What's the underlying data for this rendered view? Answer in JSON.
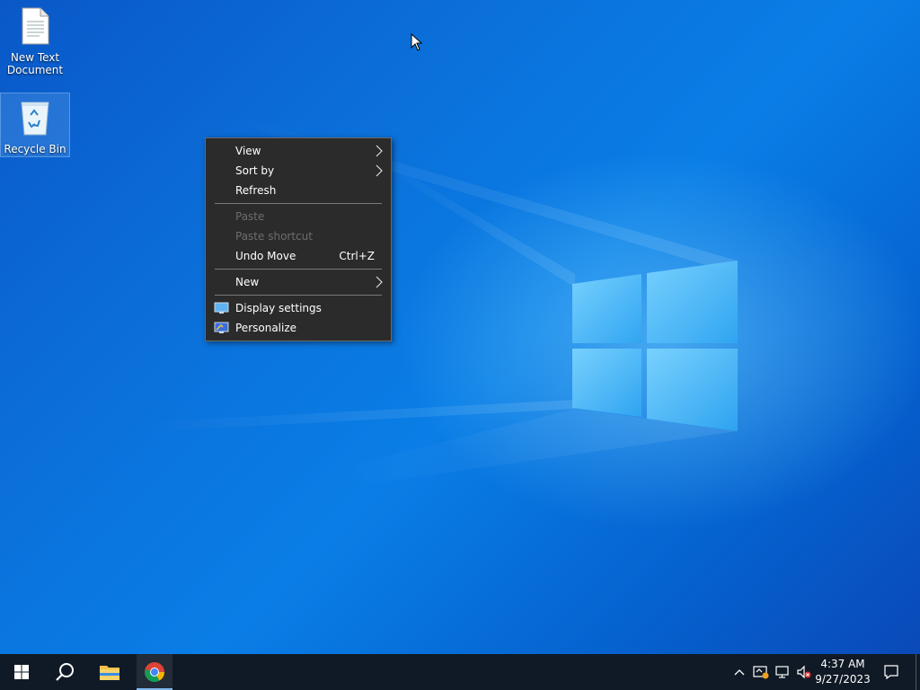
{
  "desktop": {
    "icons": [
      {
        "label": "New Text Document",
        "icon": "text-document-icon"
      },
      {
        "label": "Recycle Bin",
        "icon": "recycle-bin-icon"
      }
    ]
  },
  "context_menu": {
    "items": {
      "view": {
        "label": "View",
        "submenu": true
      },
      "sort_by": {
        "label": "Sort by",
        "submenu": true
      },
      "refresh": {
        "label": "Refresh"
      },
      "paste": {
        "label": "Paste",
        "disabled": true
      },
      "paste_shortcut": {
        "label": "Paste shortcut",
        "disabled": true
      },
      "undo_move": {
        "label": "Undo Move",
        "shortcut": "Ctrl+Z"
      },
      "new": {
        "label": "New",
        "submenu": true
      },
      "display_settings": {
        "label": "Display settings",
        "icon": "display-settings-icon"
      },
      "personalize": {
        "label": "Personalize",
        "icon": "personalize-icon"
      }
    }
  },
  "taskbar": {
    "buttons": [
      {
        "name": "start",
        "icon": "windows-start-icon"
      },
      {
        "name": "search",
        "icon": "search-icon"
      },
      {
        "name": "file-explorer",
        "icon": "folder-icon"
      },
      {
        "name": "chrome",
        "icon": "chrome-icon",
        "active": true
      }
    ],
    "tray": {
      "icons": [
        "chevron-up-icon",
        "security-icon",
        "network-icon",
        "volume-muted-icon",
        "notification-icon"
      ],
      "time": "4:37 AM",
      "date": "9/27/2023"
    }
  },
  "colors": {
    "menu_bg": "#2b2b2b",
    "menu_disabled": "#6d6d6d",
    "taskbar_bg": "#101a26",
    "desktop_blue": "#0a7ee6"
  }
}
